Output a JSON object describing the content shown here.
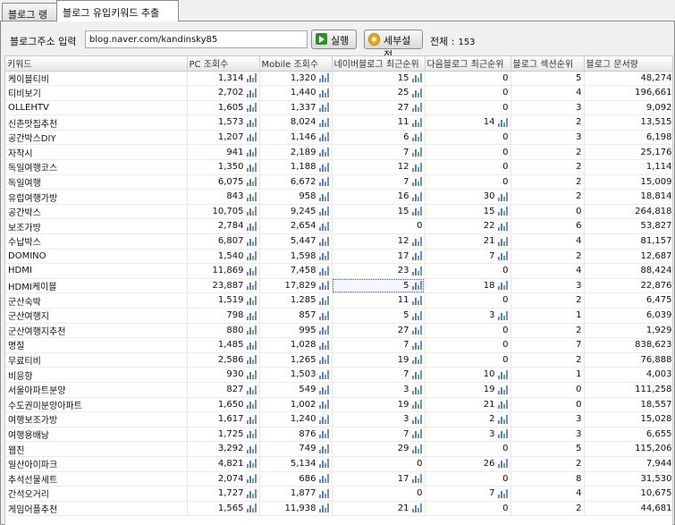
{
  "tabs": [
    {
      "label": "블로그 랭킹"
    },
    {
      "label": "블로그 유입키워드 추출"
    }
  ],
  "toolbar": {
    "address_label": "블로그주소 입력",
    "address_value": "blog.naver.com/kandinsky85",
    "run_label": "실행",
    "settings_label": "세부설정",
    "total_label": "전체 :",
    "total_count": "153"
  },
  "columns": [
    "키워드",
    "PC 조회수",
    "Mobile 조회수",
    "네이버블로그 최근순위",
    "다음블로그 최근순위",
    "블로그 섹션순위",
    "블로그 문서량"
  ],
  "rows": [
    [
      "케이블티비",
      "1,314",
      "1,320",
      "15",
      "0",
      "5",
      "48,274"
    ],
    [
      "티비보기",
      "2,702",
      "1,440",
      "25",
      "0",
      "4",
      "196,661"
    ],
    [
      "OLLEHTV",
      "1,605",
      "1,337",
      "27",
      "0",
      "3",
      "9,092"
    ],
    [
      "신촌맛집추천",
      "1,573",
      "8,024",
      "11",
      "14",
      "2",
      "13,515"
    ],
    [
      "공간박스DIY",
      "1,207",
      "1,146",
      "6",
      "0",
      "3",
      "6,198"
    ],
    [
      "자작시",
      "941",
      "2,189",
      "7",
      "0",
      "2",
      "25,176"
    ],
    [
      "독일여행코스",
      "1,350",
      "1,188",
      "12",
      "0",
      "2",
      "1,114"
    ],
    [
      "독일여행",
      "6,075",
      "6,672",
      "7",
      "0",
      "2",
      "15,009"
    ],
    [
      "유럽여행가방",
      "843",
      "958",
      "16",
      "30",
      "2",
      "18,814"
    ],
    [
      "공간박스",
      "10,705",
      "9,245",
      "15",
      "15",
      "0",
      "264,818"
    ],
    [
      "보조가방",
      "2,784",
      "2,654",
      "0",
      "22",
      "6",
      "53,827"
    ],
    [
      "수납박스",
      "6,807",
      "5,447",
      "12",
      "21",
      "4",
      "81,157"
    ],
    [
      "DOMINO",
      "1,540",
      "1,598",
      "17",
      "7",
      "2",
      "12,687"
    ],
    [
      "HDMI",
      "11,869",
      "7,458",
      "23",
      "0",
      "4",
      "88,424"
    ],
    [
      "HDMI케이블",
      "23,887",
      "17,829",
      "5",
      "18",
      "3",
      "22,876"
    ],
    [
      "군산숙박",
      "1,519",
      "1,285",
      "11",
      "0",
      "2",
      "6,475"
    ],
    [
      "군산여행지",
      "798",
      "857",
      "5",
      "3",
      "1",
      "6,039"
    ],
    [
      "군산여행지추천",
      "880",
      "995",
      "27",
      "0",
      "2",
      "1,929"
    ],
    [
      "명절",
      "1,485",
      "1,028",
      "7",
      "0",
      "7",
      "838,623"
    ],
    [
      "무료티비",
      "2,586",
      "1,265",
      "19",
      "0",
      "2",
      "76,888"
    ],
    [
      "비응항",
      "930",
      "1,503",
      "7",
      "10",
      "1",
      "4,003"
    ],
    [
      "서울아파트분양",
      "827",
      "549",
      "3",
      "19",
      "0",
      "111,258"
    ],
    [
      "수도권미분양아파트",
      "1,650",
      "1,002",
      "19",
      "21",
      "0",
      "18,557"
    ],
    [
      "여행보조가방",
      "1,617",
      "1,240",
      "3",
      "2",
      "3",
      "15,028"
    ],
    [
      "여행용배낭",
      "1,725",
      "876",
      "7",
      "3",
      "3",
      "6,655"
    ],
    [
      "웹진",
      "3,292",
      "749",
      "29",
      "0",
      "5",
      "115,206"
    ],
    [
      "일산아이파크",
      "4,821",
      "5,134",
      "0",
      "26",
      "2",
      "7,944"
    ],
    [
      "추석선물세트",
      "2,074",
      "686",
      "17",
      "0",
      "8",
      "31,530"
    ],
    [
      "간석오거리",
      "1,727",
      "1,877",
      "0",
      "7",
      "4",
      "10,675"
    ],
    [
      "게임어플추천",
      "1,565",
      "11,938",
      "21",
      "0",
      "2",
      "44,681"
    ]
  ]
}
